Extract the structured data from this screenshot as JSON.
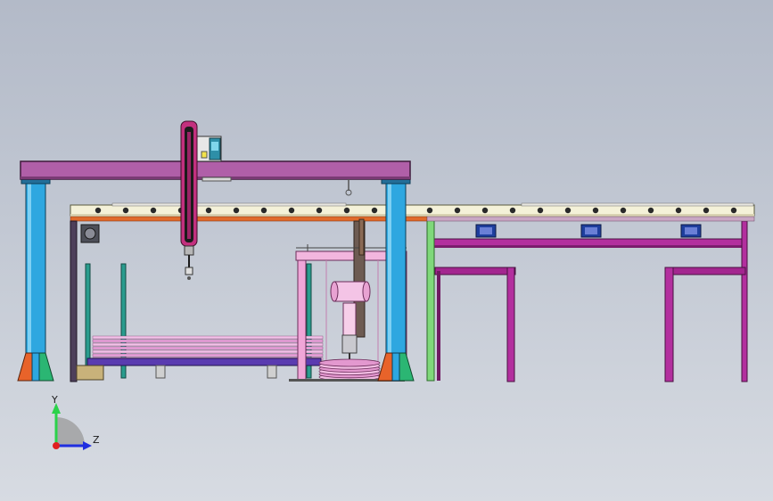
{
  "window": {
    "title": ""
  },
  "viewport": {
    "background_top": "#b3bac8",
    "background_bottom": "#d7dbe2"
  },
  "model": {
    "parts": [
      "gantry-beam",
      "gantry-leg-left",
      "gantry-leg-right",
      "vertical-manipulator",
      "roller-conveyor",
      "lift-station",
      "wheel-stack",
      "sheet-stack",
      "support-frame"
    ],
    "colors": {
      "gantry_beam": "#b05fa8",
      "legs": "#2ea7e0",
      "conveyor_rail": "#e06a2c",
      "frame_magenta": "#a0228f",
      "frame_green": "#2bb673",
      "lift_pink": "#f0a6d8",
      "bearing_blue": "#1f3f9e"
    }
  },
  "triad": {
    "y_label": "Y",
    "z_label": "Z",
    "y_color": "#2bd24a",
    "z_color": "#1f2ee0",
    "x_color": "#e01f1f"
  }
}
